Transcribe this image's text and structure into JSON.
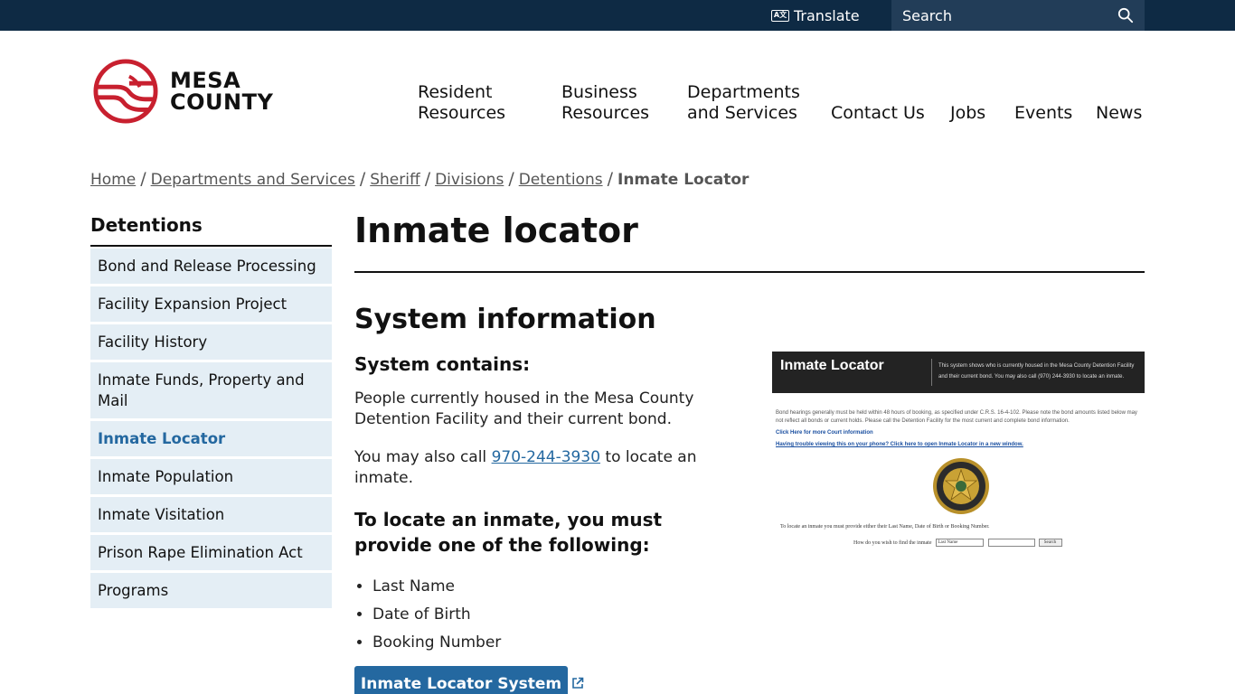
{
  "topbar": {
    "translate_label": "Translate",
    "search_placeholder": "Search"
  },
  "logo": {
    "line1": "MESA",
    "line2": "COUNTY",
    "colors": {
      "red": "#c8202f",
      "dark": "#111111"
    }
  },
  "nav": {
    "items": [
      {
        "line1": "Resident",
        "line2": "Resources"
      },
      {
        "line1": "Business",
        "line2": "Resources"
      },
      {
        "line1": "Departments",
        "line2": "and Services"
      },
      {
        "line1": "",
        "line2": "Contact Us"
      },
      {
        "line1": "",
        "line2": "Jobs"
      },
      {
        "line1": "",
        "line2": "Events"
      },
      {
        "line1": "",
        "line2": "News"
      }
    ]
  },
  "breadcrumb": {
    "items": [
      "Home",
      "Departments and Services",
      "Sheriff",
      "Divisions",
      "Detentions"
    ],
    "separator": "/",
    "current": "Inmate Locator"
  },
  "sidebar": {
    "title": "Detentions",
    "items": [
      "Bond and Release Processing",
      "Facility Expansion Project",
      "Facility History",
      "Inmate Funds, Property and Mail",
      "Inmate Locator",
      "Inmate Population",
      "Inmate Visitation",
      "Prison Rape Elimination Act",
      "Programs"
    ],
    "active_item": "Inmate Locator"
  },
  "main": {
    "title": "Inmate locator",
    "section_title": "System information",
    "contains_heading": "System contains:",
    "contains_text": "People currently housed in the Mesa County Detention Facility and their current bond.",
    "call_prefix": "You may also call ",
    "call_phone": "970-244-3930",
    "call_suffix": " to locate an inmate.",
    "provide_heading": "To locate an inmate, you must provide one of the following:",
    "criteria": [
      "Last Name",
      "Date of Birth",
      "Booking Number"
    ],
    "button_label": "Inmate Locator System"
  },
  "thumbnail": {
    "title": "Inmate Locator",
    "header_text": "This system shows who is currently housed in the Mesa County Detention Facility and their current bond. You may also call (970) 244-3930 to locate an inmate.",
    "note": "Bond hearings generally must be held within 48 hours of booking, as specified under C.R.S. 16-4-102. Please note the bond amounts listed below may not reflect all bonds or current holds. Please call the Detention Facility for the most current and complete bond information.",
    "link1": "Click Here for more Court information",
    "link2": "Having trouble viewing this on your phone? Click here to open Inmate Locator in a new window.",
    "badge_top": "MESA COUNTY SHERIFF'S OFFICE",
    "badge_bottom": "COLORADO",
    "instructions": "To locate an inmate you must provide either their Last Name, Date of Birth or Booking Number.",
    "form_label": "How do you wish to find the inmate",
    "select_value": "Last Name",
    "search_button": "Search"
  },
  "colors": {
    "topbar": "#0e2a44",
    "search_bg": "#223d58",
    "accent_blue": "#2468a0",
    "sidebar_bg": "#e4eef5",
    "logo_red": "#c8202f"
  }
}
